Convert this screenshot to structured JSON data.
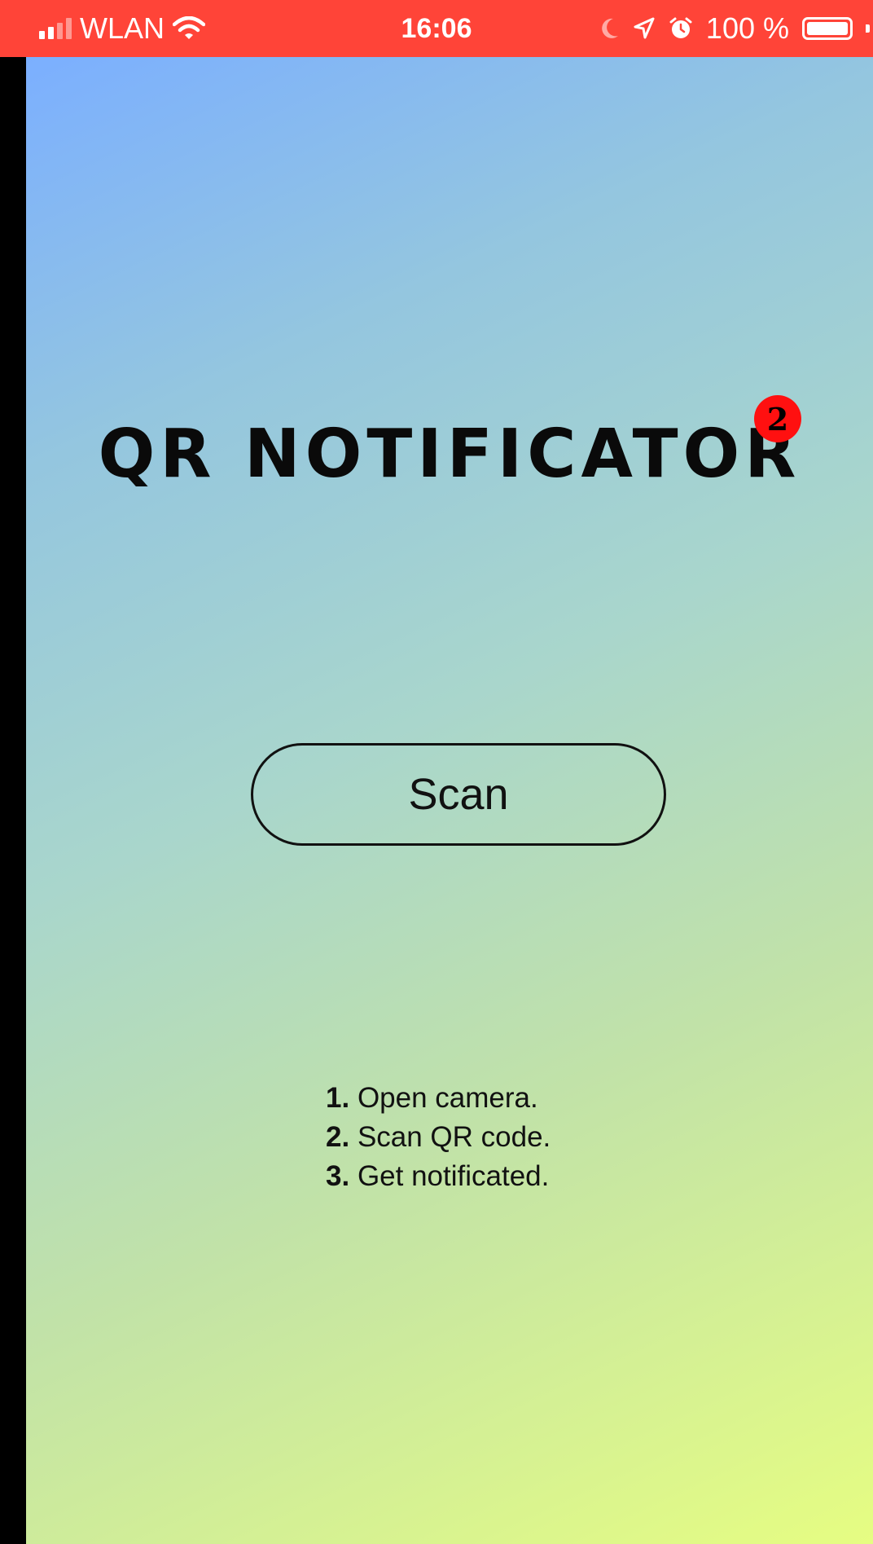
{
  "status_bar": {
    "carrier": "WLAN",
    "time": "16:06",
    "battery": "100 %",
    "background_color": "#FF4438",
    "icons": [
      "signal-bars-icon",
      "wifi-icon",
      "moon-icon",
      "location-arrow-icon",
      "alarm-icon",
      "battery-icon"
    ]
  },
  "app": {
    "title": "QR NOTIFICATOR",
    "badge_count": "2",
    "badge_color": "#FF1010",
    "scan_button_label": "Scan",
    "steps": [
      {
        "num": "1.",
        "text": "Open camera."
      },
      {
        "num": "2.",
        "text": "Scan QR code."
      },
      {
        "num": "3.",
        "text": "Get notificated."
      }
    ],
    "gradient_colors": [
      "#7BAFFF",
      "#A9D6CC",
      "#E6FD82"
    ]
  }
}
